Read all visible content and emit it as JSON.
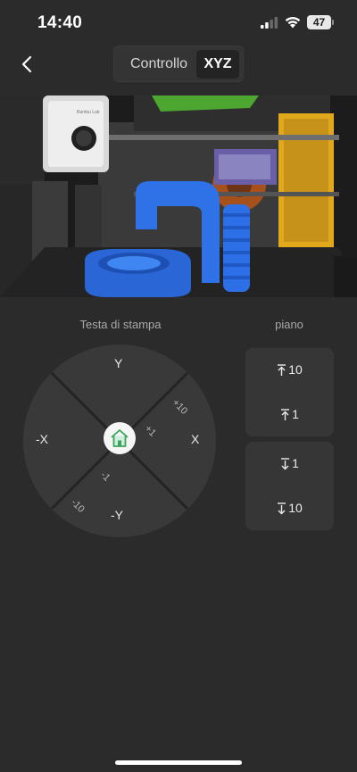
{
  "status": {
    "time": "14:40",
    "battery": "47"
  },
  "header": {
    "tabs": [
      "Controllo",
      "XYZ"
    ],
    "active_tab": "XYZ"
  },
  "camera": {
    "printer_brand": "Bambu Lab"
  },
  "print_head": {
    "title": "Testa di stampa",
    "y_plus": "Y",
    "y_minus": "-Y",
    "x_plus": "X",
    "x_minus": "-X",
    "step_plus_10": "+10",
    "step_plus_1": "+1",
    "step_minus_1": "-1",
    "step_minus_10": "-10"
  },
  "bed": {
    "title": "piano",
    "up_10": "10",
    "up_1": "1",
    "down_1": "1",
    "down_10": "10"
  },
  "colors": {
    "background": "#2b2b2b",
    "pad": "#3a3a3a",
    "home_icon": "#3aa55c"
  }
}
